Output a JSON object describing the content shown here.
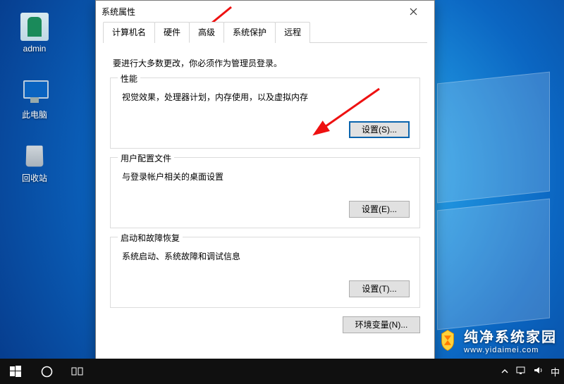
{
  "desktop_icons": {
    "admin": {
      "label": "admin"
    },
    "this_pc": {
      "label": "此电脑"
    },
    "recycle_bin": {
      "label": "回收站"
    }
  },
  "dialog": {
    "title": "系统属性",
    "instruction": "要进行大多数更改，你必须作为管理员登录。",
    "tabs": {
      "computer_name": "计算机名",
      "hardware": "硬件",
      "advanced": "高级",
      "system_protection": "系统保护",
      "remote": "远程"
    },
    "groups": {
      "performance": {
        "legend": "性能",
        "desc": "视觉效果，处理器计划，内存使用，以及虚拟内存",
        "button": "设置(S)..."
      },
      "user_profiles": {
        "legend": "用户配置文件",
        "desc": "与登录帐户相关的桌面设置",
        "button": "设置(E)..."
      },
      "startup_recovery": {
        "legend": "启动和故障恢复",
        "desc": "系统启动、系统故障和调试信息",
        "button": "设置(T)..."
      }
    },
    "env_button": "环境变量(N)..."
  },
  "tray": {
    "ime": "中"
  },
  "watermark": {
    "title": "纯净系统家园",
    "url": "www.yidaimei.com"
  }
}
